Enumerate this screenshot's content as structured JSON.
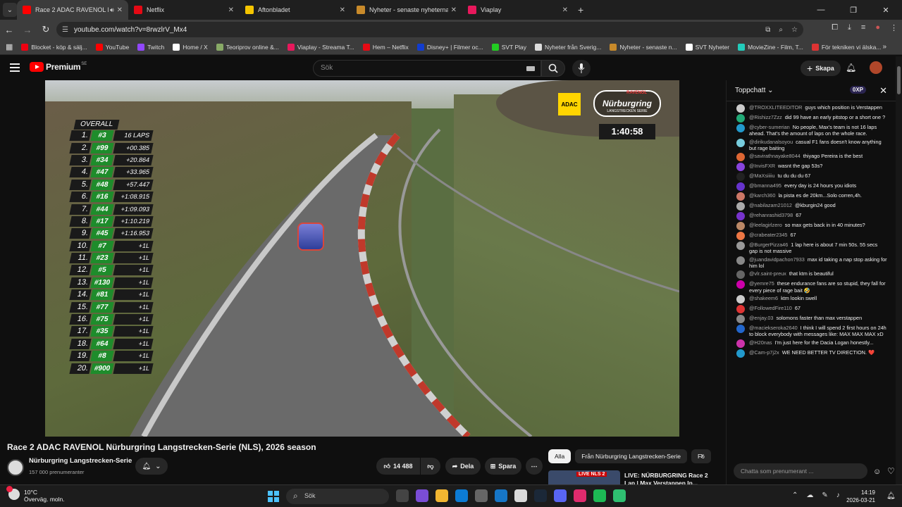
{
  "browser": {
    "tabs": [
      {
        "title": "Race 2 ADAC RAVENOL Nü",
        "active": true,
        "color": "#ff0000"
      },
      {
        "title": "Netflix",
        "active": false,
        "color": "#e50914"
      },
      {
        "title": "Aftonbladet",
        "active": false,
        "color": "#f5c500"
      },
      {
        "title": "Nyheter - senaste nyheterna i S",
        "active": false,
        "color": "#c88a2a"
      },
      {
        "title": "Viaplay",
        "active": false,
        "color": "#e8185c"
      }
    ],
    "url": "youtube.com/watch?v=8rwzlrV_Mx4",
    "bookmarks": [
      {
        "label": "Blocket - köp & sälj...",
        "color": "#e01"
      },
      {
        "label": "YouTube",
        "color": "#f00"
      },
      {
        "label": "Twitch",
        "color": "#9147ff"
      },
      {
        "label": "Home / X",
        "color": "#fff"
      },
      {
        "label": "Teoriprov online &...",
        "color": "#8a6"
      },
      {
        "label": "Viaplay - Streama T...",
        "color": "#e8185c"
      },
      {
        "label": "Hem – Netflix",
        "color": "#e50914"
      },
      {
        "label": "Disney+ | Filmer oc...",
        "color": "#113ccf"
      },
      {
        "label": "SVT Play",
        "color": "#2c2"
      },
      {
        "label": "Nyheter från Sverig...",
        "color": "#ddd"
      },
      {
        "label": "Nyheter - senaste n...",
        "color": "#c88a2a"
      },
      {
        "label": "SVT Nyheter",
        "color": "#fff"
      },
      {
        "label": "MovieZine - Film, T...",
        "color": "#2cb"
      },
      {
        "label": "För tekniken vi älska...",
        "color": "#d33"
      }
    ]
  },
  "youtube": {
    "logo": "Premium",
    "logo_region": "SE",
    "search_placeholder": "Sök",
    "create_label": "Skapa"
  },
  "video": {
    "title": "Race 2 ADAC RAVENOL Nürburgring Langstrecken-Serie (NLS), 2026 season",
    "timer": "1:40:58",
    "overall_label": "OVERALL",
    "adac": "ADAC",
    "nurburgring": "Nürburgring",
    "ravenol": "RAVENOL",
    "series_tag": "LANGSTRECKEN SERIE",
    "leaderboard": [
      {
        "pos": "1.",
        "num": "#3",
        "gap": "16 LAPS"
      },
      {
        "pos": "2.",
        "num": "#99",
        "gap": "+00.385"
      },
      {
        "pos": "3.",
        "num": "#34",
        "gap": "+20.864"
      },
      {
        "pos": "4.",
        "num": "#47",
        "gap": "+33.965"
      },
      {
        "pos": "5.",
        "num": "#48",
        "gap": "+57.447"
      },
      {
        "pos": "6.",
        "num": "#16",
        "gap": "+1:08.915"
      },
      {
        "pos": "7.",
        "num": "#44",
        "gap": "+1:09.093"
      },
      {
        "pos": "8.",
        "num": "#17",
        "gap": "+1:10.219"
      },
      {
        "pos": "9.",
        "num": "#45",
        "gap": "+1:16.953"
      },
      {
        "pos": "10.",
        "num": "#7",
        "gap": "+1L"
      },
      {
        "pos": "11.",
        "num": "#23",
        "gap": "+1L"
      },
      {
        "pos": "12.",
        "num": "#5",
        "gap": "+1L"
      },
      {
        "pos": "13.",
        "num": "#130",
        "gap": "+1L"
      },
      {
        "pos": "14.",
        "num": "#81",
        "gap": "+1L"
      },
      {
        "pos": "15.",
        "num": "#77",
        "gap": "+1L"
      },
      {
        "pos": "16.",
        "num": "#75",
        "gap": "+1L"
      },
      {
        "pos": "17.",
        "num": "#35",
        "gap": "+1L"
      },
      {
        "pos": "18.",
        "num": "#64",
        "gap": "+1L"
      },
      {
        "pos": "19.",
        "num": "#8",
        "gap": "+1L"
      },
      {
        "pos": "20.",
        "num": "#900",
        "gap": "+1L"
      }
    ]
  },
  "channel": {
    "name": "Nürburgring Langstrecken-Serie",
    "subs": "157 000 prenumeranter"
  },
  "actions": {
    "likes": "14 488",
    "share": "Dela",
    "save": "Spara"
  },
  "chips": [
    "Alla",
    "Från Nürburgring Langstrecken-Serie",
    "Fö"
  ],
  "rec": {
    "badge": "LIVE NLS 2",
    "title": "LIVE: NÜRBURGRING Race 2 Lap | Max Verstappen In..."
  },
  "chat": {
    "mode": "Toppchatt",
    "xp": "0XP",
    "input_placeholder": "Chatta som prenumerant ...",
    "messages": [
      {
        "user": "@TROXXLITEEDITOR",
        "text": "guys which position is Verstappen",
        "color": "#ccc"
      },
      {
        "user": "@Rishizz7Zzz",
        "text": "did 99 have an early pitstop or a short one ?",
        "color": "#2a7"
      },
      {
        "user": "@cyber-sumerian",
        "text": "No people, Max's team is not 16 laps ahead. That's the amount of laps on the whole race.",
        "color": "#29c"
      },
      {
        "user": "@dirikudanalsoyou",
        "text": "casual F1 fans doesn't know anything but rage baiting",
        "color": "#7cd"
      },
      {
        "user": "@savirathnayake8044",
        "text": "thiyago Pereira is the best",
        "color": "#d63"
      },
      {
        "user": "@InvisFXR",
        "text": "wasnt the gap 53s?",
        "color": "#84d"
      },
      {
        "user": "@MaXsiiiiu",
        "text": "tu du du du 67",
        "color": "#222"
      },
      {
        "user": "@bmanna495",
        "text": "every day is 24 hours you idiots",
        "color": "#63c"
      },
      {
        "user": "@karch360",
        "text": "la pista es de 20km...Solo corren,4h.",
        "color": "#c76"
      },
      {
        "user": "@nabilazam21012",
        "text": "@kburgin24 good",
        "color": "#aaa"
      },
      {
        "user": "@rehanrashid3798",
        "text": "67",
        "color": "#73c"
      },
      {
        "user": "@leelagirlzero",
        "text": "so max gets back in in 40 minutes?",
        "color": "#b86"
      },
      {
        "user": "@crabeater2345",
        "text": "67",
        "color": "#e74"
      },
      {
        "user": "@BurgerPizza46",
        "text": "1 lap here is about 7 min 50s. 55 secs gap is not massive",
        "color": "#999"
      },
      {
        "user": "@juandavidpachon7933",
        "text": "max id taking a nap stop asking for him lol",
        "color": "#888"
      },
      {
        "user": "@vlr.saint-preux",
        "text": "that ktm is beautiful",
        "color": "#666"
      },
      {
        "user": "@yemre75",
        "text": "these endurance fans are so stupid, they fall for every piece of rage bait 🤣",
        "color": "#c0a"
      },
      {
        "user": "@shakeem6",
        "text": "ktm lookin swell",
        "color": "#ccc"
      },
      {
        "user": "@FollowedFire110",
        "text": "67",
        "color": "#d33"
      },
      {
        "user": "@enjay.03",
        "text": "solomons faster than max verstappen",
        "color": "#888"
      },
      {
        "user": "@maciekseroka2640",
        "text": "I think I will spend 2 first hours on 24h to block everybody with messages like: MAX MAX MAX xD",
        "color": "#26c"
      },
      {
        "user": "@H20nas",
        "text": "I'm just here for the Dacia Logan honestly...",
        "color": "#c3a"
      },
      {
        "user": "@Cam-p7j2x",
        "text": "WE NEED BETTER TV DIRECTION. ❤️",
        "color": "#29c"
      }
    ]
  },
  "taskbar": {
    "temp": "10°C",
    "weather": "Överväg. moln.",
    "search": "Sök",
    "time": "14:19",
    "date": "2026-03-21",
    "apps": [
      "#444",
      "#7a4dd6",
      "#f2b631",
      "#0c7bd4",
      "#666",
      "#1676c7",
      "#dadada",
      "#1b2838",
      "#5865f2",
      "#e02b6d",
      "#1db954",
      "#2fbf71"
    ]
  }
}
